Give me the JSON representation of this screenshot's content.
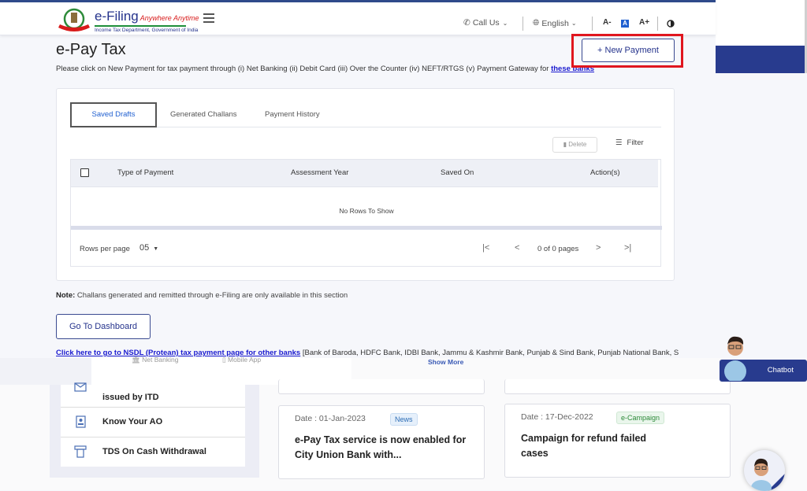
{
  "header": {
    "brand_name": "e-Filing",
    "brand_tagline": "Anywhere Anytime",
    "brand_subtitle": "Income Tax Department, Government of India",
    "call_us": "Call Us",
    "language": "English",
    "font_decrease": "A-",
    "font_normal": "A",
    "font_increase": "A+"
  },
  "page": {
    "title": "e-Pay Tax",
    "intro_text": "Please click on New Payment for tax payment through (i) Net Banking (ii) Debit Card (iii) Over the Counter (iv) NEFT/RTGS (v) Payment Gateway for ",
    "intro_link": "these banks",
    "new_payment_label": "+ New Payment"
  },
  "tabs": [
    {
      "label": "Saved Drafts",
      "active": true
    },
    {
      "label": "Generated Challans",
      "active": false
    },
    {
      "label": "Payment History",
      "active": false
    }
  ],
  "toolbar": {
    "delete_label": "Delete",
    "filter_label": "Filter"
  },
  "table": {
    "columns": [
      "Type of Payment",
      "Assessment Year",
      "Saved On",
      "Action(s)"
    ],
    "empty_message": "No Rows To Show",
    "rows_per_page_label": "Rows per page",
    "rows_per_page_value": "05",
    "page_status": "0 of 0 pages"
  },
  "note": {
    "label": "Note:",
    "text": " Challans generated and remitted through e-Filing are only available in this section"
  },
  "dashboard_button": "Go To Dashboard",
  "nsdl": {
    "link": "Click here to go to NSDL (Protean) tax payment page for other banks",
    "text": " [Bank of Baroda, HDFC Bank, IDBI Bank, Jammu & Kashmir Bank, Punjab & Sind Bank, Punjab National Bank, State"
  },
  "background": {
    "ghost_items": [
      "Net Banking",
      "Mobile App"
    ],
    "show_more": "Show More",
    "quick_links": [
      {
        "label": "Authenticate notice/order issued by ITD",
        "visible_label": "issued by ITD"
      },
      {
        "label": "Know Your AO"
      },
      {
        "label": "TDS On Cash Withdrawal"
      }
    ],
    "news": [
      {
        "date": "Date : 01-Jan-2023",
        "badge": "News",
        "headline": "e-Pay Tax service is now enabled for City Union Bank with..."
      },
      {
        "date": "Date : 17-Dec-2022",
        "badge": "e-Campaign",
        "headline": "Campaign for refund failed cases"
      }
    ],
    "chatbot_label": "Chatbot"
  },
  "colors": {
    "brand_blue": "#25338c",
    "accent_link": "#1a1acf",
    "highlight_red": "#e0161e",
    "active_tab": "#1f5fd0"
  }
}
